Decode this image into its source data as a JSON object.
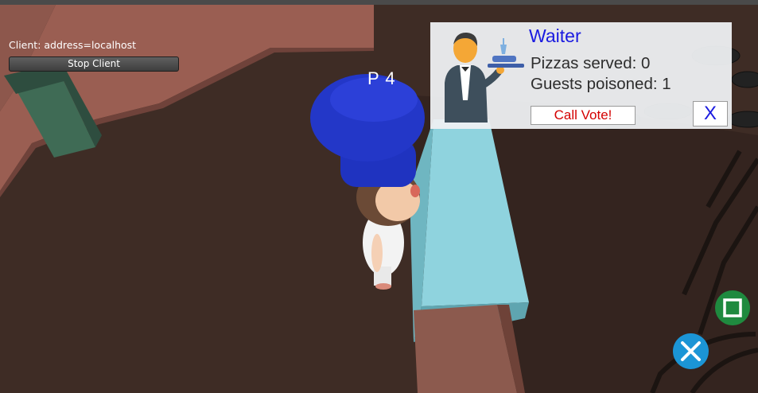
{
  "network": {
    "client_status": "Client: address=localhost",
    "stop_button_label": "Stop Client"
  },
  "player": {
    "tag": "P 4"
  },
  "role_panel": {
    "role_name": "Waiter",
    "pizzas_served": "Pizzas served: 0",
    "guests_poisoned": "Guests poisoned: 1",
    "vote_button_label": "Call Vote!",
    "close_button_label": "X",
    "icon": "waiter-icon"
  },
  "action_buttons": {
    "square_icon": "square-action-icon",
    "cross_icon": "cross-action-icon"
  },
  "colors": {
    "role_title": "#1a1ae0",
    "vote_text": "#d40000",
    "square_button": "#1f8a3f",
    "cross_button": "#1b95d6",
    "counter": "#8fd3de",
    "chef_hat": "#2337c8"
  }
}
